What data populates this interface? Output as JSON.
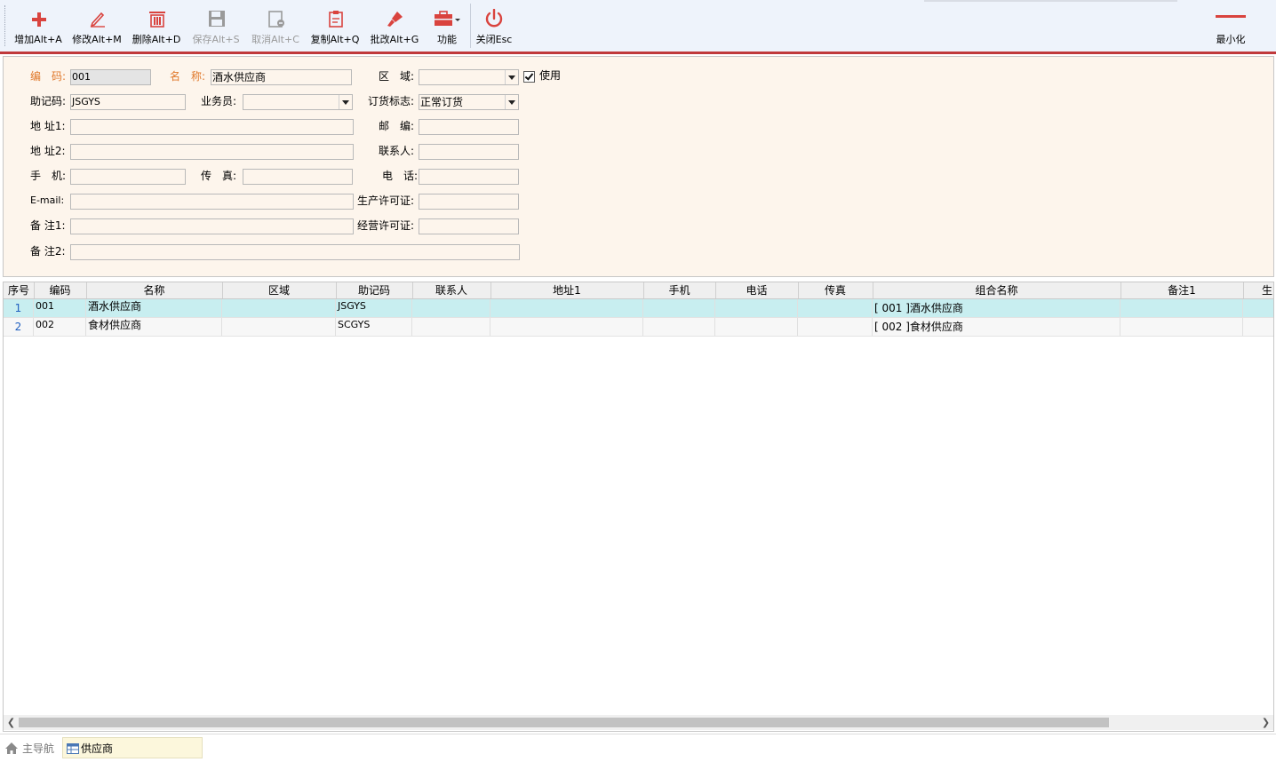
{
  "toolbar": {
    "add": "增加Alt+A",
    "edit": "修改Alt+M",
    "delete": "删除Alt+D",
    "save": "保存Alt+S",
    "cancel": "取消Alt+C",
    "copy": "复制Alt+Q",
    "batch_edit": "批改Alt+G",
    "functions": "功能",
    "close": "关闭Esc",
    "minimize": "最小化",
    "accent_color": "#d9433e",
    "icons": [
      "plus-icon",
      "pencil-icon",
      "trash-icon",
      "floppy-icon",
      "cancel-doc-icon",
      "clipboard-icon",
      "brush-icon",
      "toolbox-icon",
      "power-icon",
      "minimize-icon"
    ]
  },
  "form": {
    "code_label": "编　码:",
    "code_value": "001",
    "name_label": "名　称:",
    "name_value": "酒水供应商",
    "region_label": "区　域:",
    "region_value": "",
    "use_label": "使用",
    "use_checked": true,
    "mnemonic_label": "助记码:",
    "mnemonic_value": "JSGYS",
    "salesman_label": "业务员:",
    "salesman_value": "",
    "order_flag_label": "订货标志:",
    "order_flag_value": "正常订货",
    "addr1_label": "地 址1:",
    "addr1_value": "",
    "postcode_label": "邮　编:",
    "postcode_value": "",
    "addr2_label": "地 址2:",
    "addr2_value": "",
    "contact_label": "联系人:",
    "contact_value": "",
    "mobile_label": "手　机:",
    "mobile_value": "",
    "fax_label": "传　真:",
    "fax_value": "",
    "phone_label": "电　话:",
    "phone_value": "",
    "email_label": "E-mail:",
    "email_value": "",
    "license_label": "生产许可证:",
    "license_value": "",
    "biz_license_label": "经营许可证:",
    "biz_license_value": "",
    "note1_label": "备 注1:",
    "note1_value": "",
    "note2_label": "备 注2:",
    "note2_value": ""
  },
  "grid": {
    "columns": [
      "序号",
      "编码",
      "名称",
      "区域",
      "助记码",
      "联系人",
      "地址1",
      "手机",
      "电话",
      "传真",
      "组合名称",
      "备注1",
      "生"
    ],
    "rows": [
      {
        "no": "1",
        "code": "001",
        "name": "酒水供应商",
        "region": "",
        "mnemonic": "JSGYS",
        "contact": "",
        "addr1": "",
        "mobile": "",
        "phone": "",
        "fax": "",
        "combo": "[ 001 ]酒水供应商",
        "note1": ""
      },
      {
        "no": "2",
        "code": "002",
        "name": "食材供应商",
        "region": "",
        "mnemonic": "SCGYS",
        "contact": "",
        "addr1": "",
        "mobile": "",
        "phone": "",
        "fax": "",
        "combo": "[ 002 ]食材供应商",
        "note1": ""
      }
    ]
  },
  "statusbar": {
    "home_tab": "主导航",
    "current_tab": "供应商"
  }
}
